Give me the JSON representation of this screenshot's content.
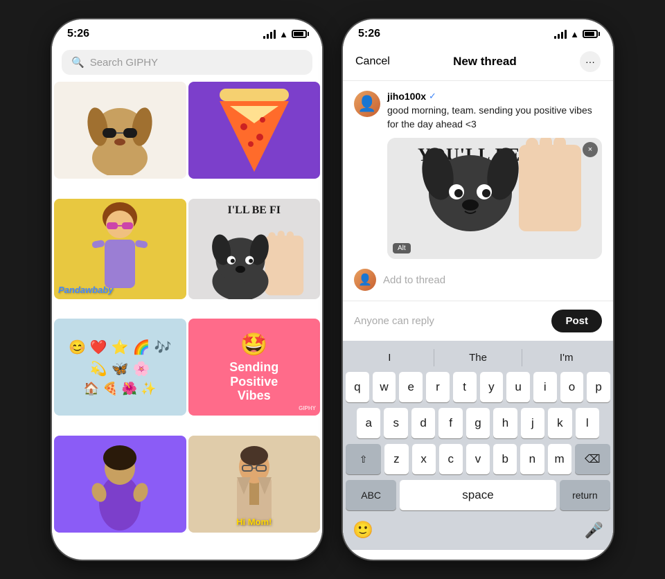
{
  "left_phone": {
    "status_bar": {
      "time": "5:26"
    },
    "search": {
      "placeholder": "Search GIPHY"
    },
    "gifs": [
      {
        "id": "dog-sunglasses",
        "label": "Dog with sunglasses"
      },
      {
        "id": "pizza-slice",
        "label": "Pizza slice"
      },
      {
        "id": "girl-sunglasses",
        "label": "Girl with sunglasses",
        "overlay": "Pandawbaby"
      },
      {
        "id": "puppy-fine",
        "label": "You'll be fine puppy",
        "overlay": "I'LL BE FI"
      },
      {
        "id": "fridge-magnets",
        "label": "Fridge magnets"
      },
      {
        "id": "positive-vibes",
        "label": "Sending Positive Vibes",
        "text": "Sending\nPositive\nVibes",
        "branding": "GIPHY"
      },
      {
        "id": "woman-clap",
        "label": "Woman clapping"
      },
      {
        "id": "hi-mom",
        "label": "Hi Mom",
        "overlay": "Hi Mom!"
      }
    ]
  },
  "right_phone": {
    "status_bar": {
      "time": "5:26"
    },
    "header": {
      "cancel_label": "Cancel",
      "title": "New thread",
      "more_icon": "···"
    },
    "post": {
      "username": "jiho100x",
      "verified": true,
      "text": "good morning, team. sending you positive vibes for the day ahead <3",
      "gif_banner": "YOU'LL BE FINE",
      "gif_alt": "Alt",
      "gif_close": "×"
    },
    "add_to_thread": {
      "label": "Add to thread"
    },
    "reply_bar": {
      "placeholder": "Anyone can reply",
      "post_label": "Post"
    },
    "keyboard": {
      "suggestions": [
        "I",
        "The",
        "I'm"
      ],
      "rows": [
        [
          "q",
          "w",
          "e",
          "r",
          "t",
          "y",
          "u",
          "i",
          "o",
          "p"
        ],
        [
          "a",
          "s",
          "d",
          "f",
          "g",
          "h",
          "j",
          "k",
          "l"
        ],
        [
          "z",
          "x",
          "c",
          "v",
          "b",
          "n",
          "m"
        ],
        [
          "ABC",
          "space",
          "return"
        ]
      ],
      "shift_label": "⇧",
      "delete_label": "⌫",
      "emoji_label": "🙂",
      "mic_label": "🎤"
    }
  }
}
